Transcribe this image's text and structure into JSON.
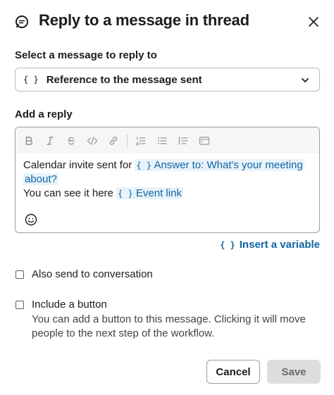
{
  "header": {
    "title": "Reply to a message in thread",
    "title_icon": "message-thread-icon",
    "close_icon": "close-icon"
  },
  "select_message": {
    "label": "Select a message to reply to",
    "brace": "{ }",
    "value": "Reference to the message sent",
    "chevron_icon": "chevron-down-icon"
  },
  "reply": {
    "label": "Add a reply",
    "toolbar": [
      "bold",
      "italic",
      "strikethrough",
      "code",
      "link",
      "numbered-list",
      "bulleted-list",
      "quote",
      "code-block"
    ],
    "line1_text": "Calendar invite sent for ",
    "line1_var_brace": "{ }",
    "line1_var": "Answer to: What's your meeting",
    "line1_var_cont": "about?",
    "line2_text": "You can see it here ",
    "line2_var_brace": "{ }",
    "line2_var": "Event link",
    "emoji_icon": "emoji-icon"
  },
  "insert_variable": {
    "brace": "{ }",
    "label": "Insert a variable"
  },
  "options": {
    "send_to_conversation": {
      "label": "Also send to conversation",
      "checked": false
    },
    "include_button": {
      "label": "Include a button",
      "checked": false,
      "description": "You can add a button to this message. Clicking it will move people to the next step of the workflow."
    }
  },
  "footer": {
    "cancel_label": "Cancel",
    "save_label": "Save"
  },
  "colors": {
    "accent": "#1264a3",
    "variable_bg": "#e8f3fb",
    "text": "#1d1c1d",
    "save_disabled_bg": "#dddddd"
  }
}
